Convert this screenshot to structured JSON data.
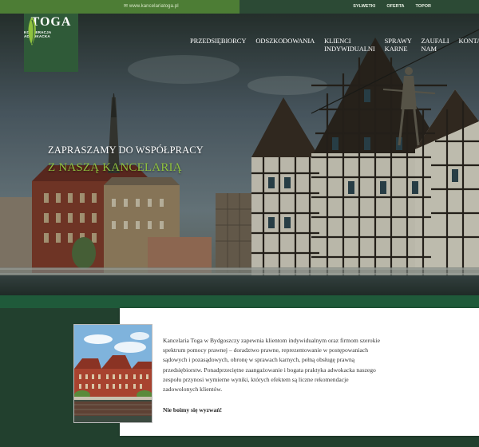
{
  "topbar": {
    "email": "✉ www.kancelariatoga.pl",
    "links": [
      "SYLWETKI",
      "OFERTA",
      "TOPOR"
    ]
  },
  "logo": {
    "name": "TOGA",
    "subtitle": "KOOPERACJA ADWOKACKA"
  },
  "nav": {
    "items": [
      "PRZEDSIĘBIORCY",
      "ODSZKODOWANIA",
      "KLIENCI INDYWIDUALNI",
      "SPRAWY KARNE",
      "ZAUFALI NAM",
      "KONTAKT"
    ]
  },
  "hero": {
    "line1": "ZAPRASZAMY DO WSPÓŁPRACY",
    "line2": "Z NASZĄ KANCELARIĄ"
  },
  "intro": {
    "paragraph": "Kancelaria Toga w Bydgoszczy zapewnia klientom indywidualnym oraz firmom szerokie spektrum pomocy prawnej – doradztwo prawne, reprezentowanie w postępowaniach sądowych i pozasądowych, obronę w sprawach karnych, pełną obsługę prawną przedsiębiorstw. Ponadprzeciętne zaangażowanie i bogata praktyka adwokacka naszego zespołu przynosi wymierne wyniki, których efektem są liczne rekomendacje zadowolonych klientów.",
    "tagline": "Nie boimy się wyzwań!"
  },
  "colors": {
    "brand_green": "#2f5a38",
    "accent_green": "#8fc23f",
    "band": "#1f5a3a"
  }
}
